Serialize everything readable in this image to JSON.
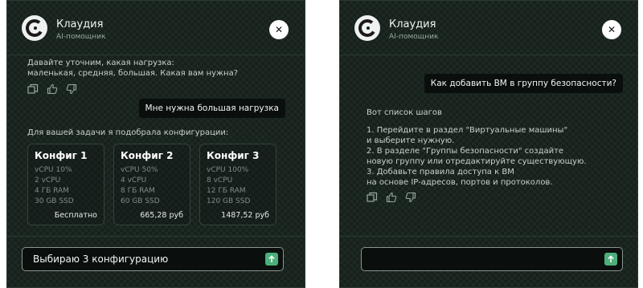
{
  "colors": {
    "panel_bg": "#16211c",
    "accent_green": "#4caf7a",
    "bubble_bg": "#0a0f0d"
  },
  "panel1": {
    "header": {
      "name": "Клаудия",
      "role": "AI-помощник"
    },
    "messages": {
      "bot_question": [
        "Давайте уточним, какая нагрузка:",
        "маленькая, средняя, большая. Какая вам нужна?"
      ],
      "user_reply": "Мне нужна большая нагрузка",
      "bot_intro": "Для вашей задачи я подобрала конфигурации:"
    },
    "configs": [
      {
        "title": "Конфиг 1",
        "specs": [
          "vCPU 10%",
          "2 vCPU",
          "4 ГБ RAM",
          "30 GB SSD"
        ],
        "price": "Бесплатно"
      },
      {
        "title": "Конфиг 2",
        "specs": [
          "vCPU 50%",
          "4 vCPU",
          "8 ГБ RAM",
          "60 GB SSD"
        ],
        "price": "665,28 руб"
      },
      {
        "title": "Конфиг 3",
        "specs": [
          "vCPU 100%",
          "8 vCPU",
          "12 ГБ RAM",
          "120 GB SSD"
        ],
        "price": "1487,52 руб"
      }
    ],
    "input": {
      "value": "Выбираю 3 конфигурацию"
    }
  },
  "panel2": {
    "header": {
      "name": "Клаудия",
      "role": "AI-помощник"
    },
    "messages": {
      "user_question": "Как добавить ВМ в группу безопасности?",
      "bot_answer": [
        "Вот список шагов",
        "",
        "1. Перейдите в раздел \"Виртуальные машины\"",
        "и выберите нужную.",
        "2. В разделе \"Группы безопасности\" создайте",
        "новую группу или отредактируйте существующую.",
        "3. Добавьте правила доступа к ВМ",
        "на основе IP-адресов, портов и протоколов."
      ]
    },
    "input": {
      "value": ""
    }
  },
  "icons": [
    "logo-icon",
    "close-icon",
    "copy-icon",
    "thumbs-up-icon",
    "thumbs-down-icon",
    "send-arrow-icon"
  ]
}
